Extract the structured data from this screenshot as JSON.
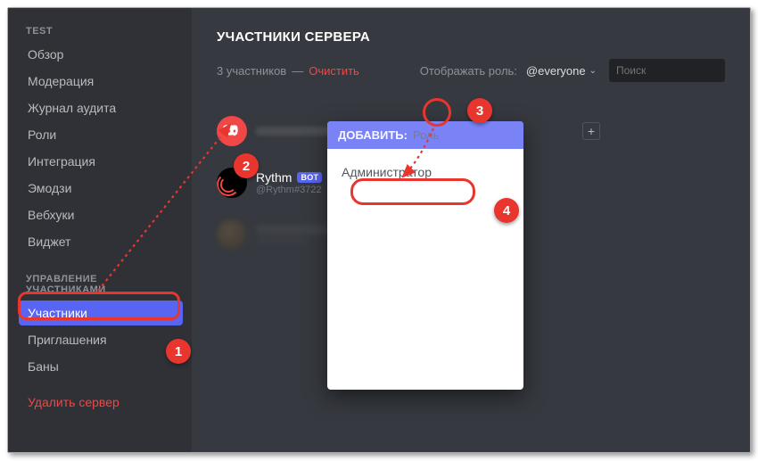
{
  "sidebar": {
    "section1_title": "TEST",
    "items1": [
      {
        "label": "Обзор"
      },
      {
        "label": "Модерация"
      },
      {
        "label": "Журнал аудита"
      },
      {
        "label": "Роли"
      },
      {
        "label": "Интеграция"
      },
      {
        "label": "Эмодзи"
      },
      {
        "label": "Вебхуки"
      },
      {
        "label": "Виджет"
      }
    ],
    "section2_title": "УПРАВЛЕНИЕ УЧАСТНИКАМИ",
    "items2": [
      {
        "label": "Участники"
      },
      {
        "label": "Приглашения"
      },
      {
        "label": "Баны"
      }
    ],
    "delete_label": "Удалить сервер"
  },
  "header": {
    "title": "УЧАСТНИКИ СЕРВЕРА"
  },
  "filter": {
    "count_text": "3 участников",
    "dash": "—",
    "clear_label": "Очистить",
    "display_role_label": "Отображать роль:",
    "role_value": "@everyone",
    "search_placeholder": "Поиск"
  },
  "members": {
    "rythm_name": "Rythm",
    "rythm_tag": "@Rythm#3722",
    "bot_badge": "BOT"
  },
  "popover": {
    "header_label": "ДОБАВИТЬ:",
    "header_placeholder": "Роль",
    "items": [
      {
        "label": "Администратор"
      }
    ]
  },
  "steps": {
    "s1": "1",
    "s2": "2",
    "s3": "3",
    "s4": "4"
  }
}
